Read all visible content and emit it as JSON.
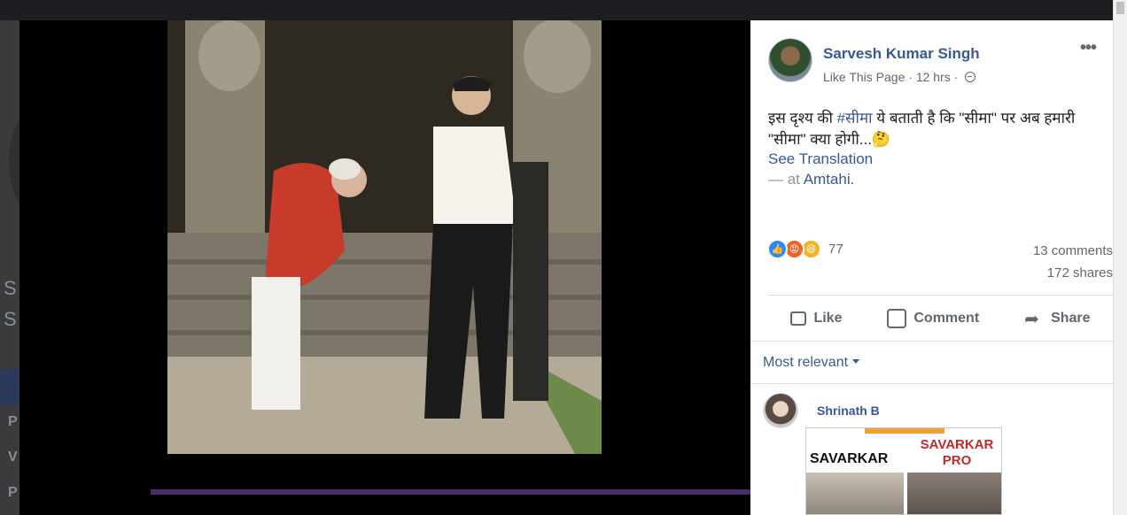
{
  "post": {
    "author": "Sarvesh Kumar Singh",
    "like_page": "Like This Page",
    "separator": "·",
    "time": "12 hrs",
    "more_label": "•••",
    "text_before_tag": "इस दृश्य की ",
    "hashtag": "#सीमा",
    "text_after_tag": " ये बताती है कि \"सीमा\" पर अब हमारी \"सीमा\" क्या होगी...🤔",
    "see_translation": "See Translation",
    "at_prefix": "— at ",
    "location": "Amtahi.",
    "reaction_count": "77",
    "comments": "13 comments",
    "shares": "172 shares"
  },
  "actions": {
    "like": "Like",
    "comment": "Comment",
    "share": "Share"
  },
  "comments_section": {
    "sort_label": "Most relevant",
    "first_comment": {
      "author": "Shrinath B",
      "image_text_left": "SAVARKAR",
      "image_text_right": "SAVARKAR PRO"
    }
  },
  "icons": {
    "globe": "globe-icon",
    "like": "thumbs-up-icon",
    "comment": "speech-bubble-icon",
    "share": "share-arrow-icon"
  },
  "colors": {
    "link": "#385898",
    "secondary_text": "#606770",
    "like_reaction": "#2d88ff",
    "angry_reaction": "#f0632a",
    "haha_reaction": "#f7b125"
  }
}
